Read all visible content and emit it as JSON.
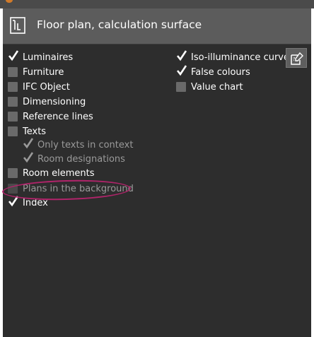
{
  "panel": {
    "title": "Floor plan, calculation surface"
  },
  "left_options": [
    {
      "label": "Luminaires",
      "checked": true,
      "enabled": true
    },
    {
      "label": "Furniture",
      "checked": false,
      "enabled": true
    },
    {
      "label": "IFC Object",
      "checked": false,
      "enabled": true
    },
    {
      "label": "Dimensioning",
      "checked": false,
      "enabled": true
    },
    {
      "label": "Reference lines",
      "checked": false,
      "enabled": true
    },
    {
      "label": "Texts",
      "checked": false,
      "enabled": true
    },
    {
      "label": "Only texts in context",
      "checked": true,
      "enabled": false
    },
    {
      "label": "Room designations",
      "checked": true,
      "enabled": false
    },
    {
      "label": "Room elements",
      "checked": false,
      "enabled": true
    },
    {
      "label": "Plans in the background",
      "checked": false,
      "enabled": false
    },
    {
      "label": "Index",
      "checked": true,
      "enabled": true
    }
  ],
  "right_options": [
    {
      "label": "Iso-illuminance curves",
      "checked": true,
      "enabled": true
    },
    {
      "label": "False colours",
      "checked": true,
      "enabled": true
    },
    {
      "label": "Value chart",
      "checked": false,
      "enabled": true
    }
  ],
  "icons": {
    "header": "floor-plan-icon",
    "edit": "edit-settings-icon",
    "check": "checkmark-icon"
  },
  "colors": {
    "panel_bg": "#2d2d2d",
    "header_bg": "#5c5c5c",
    "annotation": "#b0246a"
  }
}
